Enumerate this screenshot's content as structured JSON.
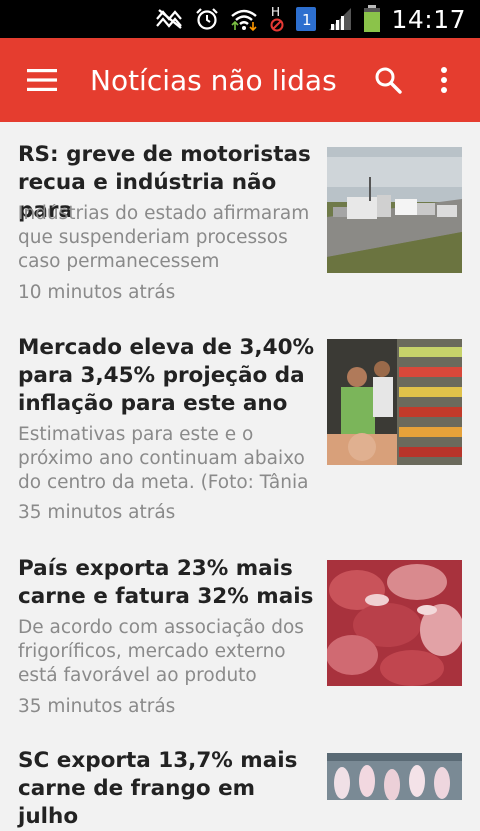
{
  "status_bar": {
    "time": "14:17",
    "icons": [
      "no-signal-icon",
      "alarm-icon",
      "wifi-icon",
      "hd-blocked-icon",
      "notification-1-icon",
      "signal-icon",
      "battery-icon"
    ],
    "notification_count": "1",
    "h_label": "H"
  },
  "app_bar": {
    "title": "Notícias não lidas",
    "color": "#e53d2f",
    "icons": [
      "menu-icon",
      "search-icon",
      "more-vert-icon"
    ]
  },
  "articles": [
    {
      "headline": "RS: greve de motoristas recua e indústria não para",
      "summary": "Indústrias do estado afirmaram que suspenderiam processos caso permanecessem",
      "time": "10 minutos atrás",
      "thumbnail": "trucks-on-highway"
    },
    {
      "headline": "Mercado eleva de 3,40% para 3,45% projeção da inflação para este ano",
      "summary": "Estimativas para este e o próximo ano continuam abaixo do centro da meta. (Foto: Tânia",
      "time": "35 minutos atrás",
      "thumbnail": "supermarket-shoppers"
    },
    {
      "headline": "País exporta 23% mais carne e fatura 32% mais",
      "summary": "De acordo com associação dos frigoríficos, mercado externo está favorável ao produto",
      "time": "35 minutos atrás",
      "thumbnail": "raw-meat"
    },
    {
      "headline": "SC exporta 13,7% mais carne de frango em julho",
      "summary": "",
      "time": "",
      "thumbnail": "chicken-processing"
    }
  ]
}
